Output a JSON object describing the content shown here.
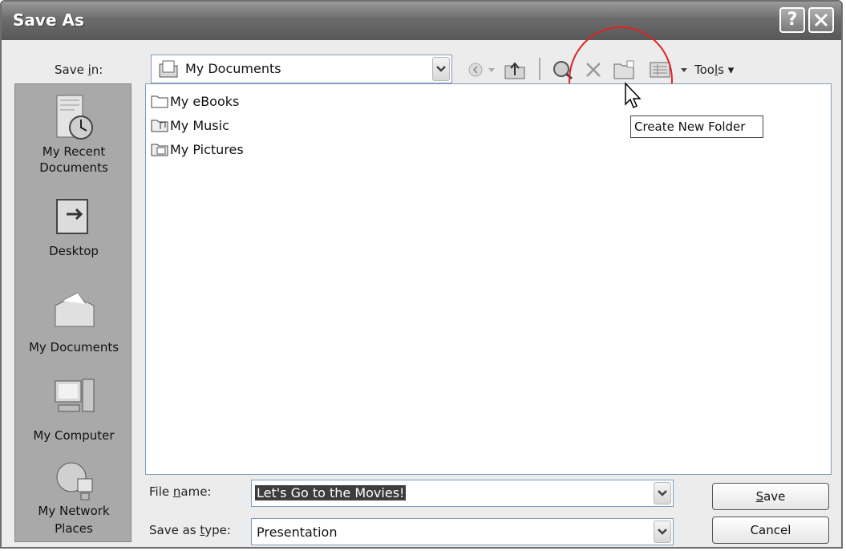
{
  "window": {
    "title": "Save As"
  },
  "toolbar": {
    "save_in_label": "Save in:",
    "save_in_value": "My Documents",
    "tools_label": "Tools"
  },
  "places": [
    {
      "label_1": "My Recent",
      "label_2": "Documents"
    },
    {
      "label_1": "Desktop",
      "label_2": ""
    },
    {
      "label_1": "My Documents",
      "label_2": ""
    },
    {
      "label_1": "My Computer",
      "label_2": ""
    },
    {
      "label_1": "My Network",
      "label_2": "Places"
    }
  ],
  "files": [
    "My eBooks",
    "My Music",
    "My Pictures"
  ],
  "tooltip": "Create New Folder",
  "form": {
    "file_name_label": "File name:",
    "file_name_value": "Let's Go to the Movies!",
    "save_type_label": "Save as type:",
    "save_type_value": "Presentation",
    "save_button": "Save",
    "cancel_button": "Cancel"
  }
}
